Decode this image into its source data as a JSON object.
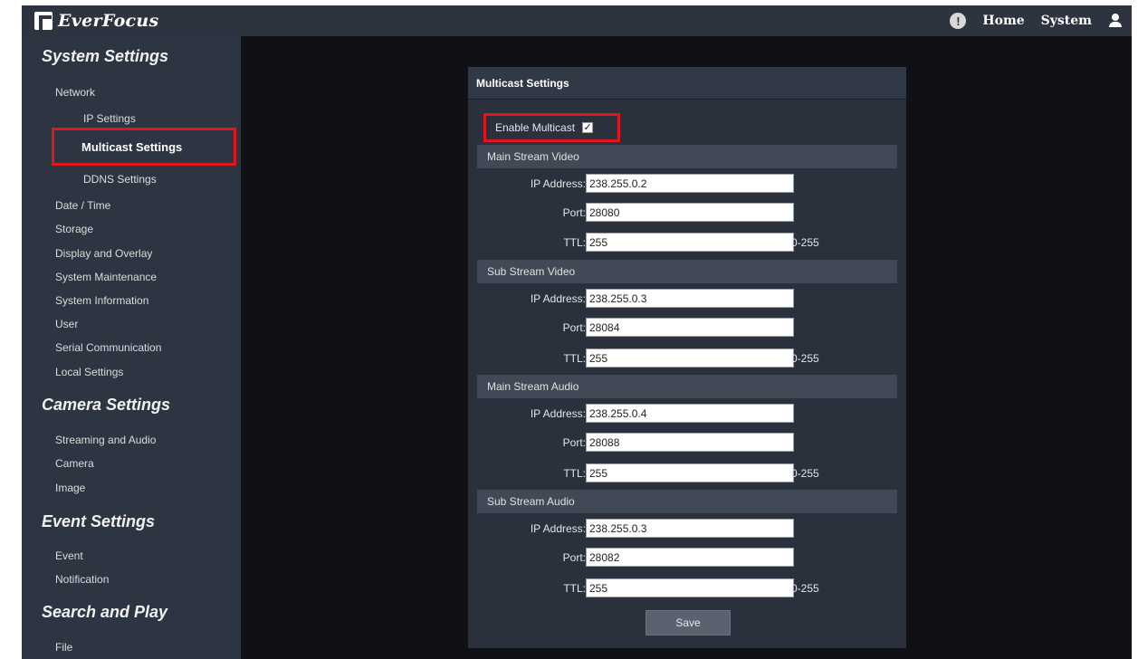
{
  "brand": {
    "name": "EverFocus"
  },
  "topnav": {
    "home": "Home",
    "system": "System"
  },
  "sidebar": {
    "system_settings": {
      "title": "System Settings",
      "network": "Network",
      "ip_settings": "IP Settings",
      "multicast_settings": "Multicast Settings",
      "ddns_settings": "DDNS Settings",
      "items": [
        "Date / Time",
        "Storage",
        "Display and Overlay",
        "System Maintenance",
        "System Information",
        "User",
        "Serial Communication",
        "Local Settings"
      ]
    },
    "camera_settings": {
      "title": "Camera Settings",
      "items": [
        "Streaming and Audio",
        "Camera",
        "Image"
      ]
    },
    "event_settings": {
      "title": "Event Settings",
      "items": [
        "Event",
        "Notification"
      ]
    },
    "search_and_play": {
      "title": "Search and Play",
      "items": [
        "File"
      ]
    }
  },
  "panel": {
    "title": "Multicast Settings",
    "enable_label": "Enable Multicast",
    "enable_checked": true,
    "field_labels": {
      "ip": "IP Address:",
      "port": "Port:",
      "ttl": "TTL:"
    },
    "ttl_hint": "0-255",
    "groups": [
      {
        "title": "Main Stream Video",
        "ip": "238.255.0.2",
        "port": "28080",
        "ttl": "255"
      },
      {
        "title": "Sub Stream Video",
        "ip": "238.255.0.3",
        "port": "28084",
        "ttl": "255"
      },
      {
        "title": "Main Stream Audio",
        "ip": "238.255.0.4",
        "port": "28088",
        "ttl": "255"
      },
      {
        "title": "Sub Stream Audio",
        "ip": "238.255.0.3",
        "port": "28082",
        "ttl": "255"
      }
    ],
    "save_label": "Save"
  },
  "colors": {
    "highlight": "#e0161c",
    "sidebar_bg": "#2e3542",
    "panel_bg": "#2a313d",
    "main_bg": "#0f1114"
  }
}
